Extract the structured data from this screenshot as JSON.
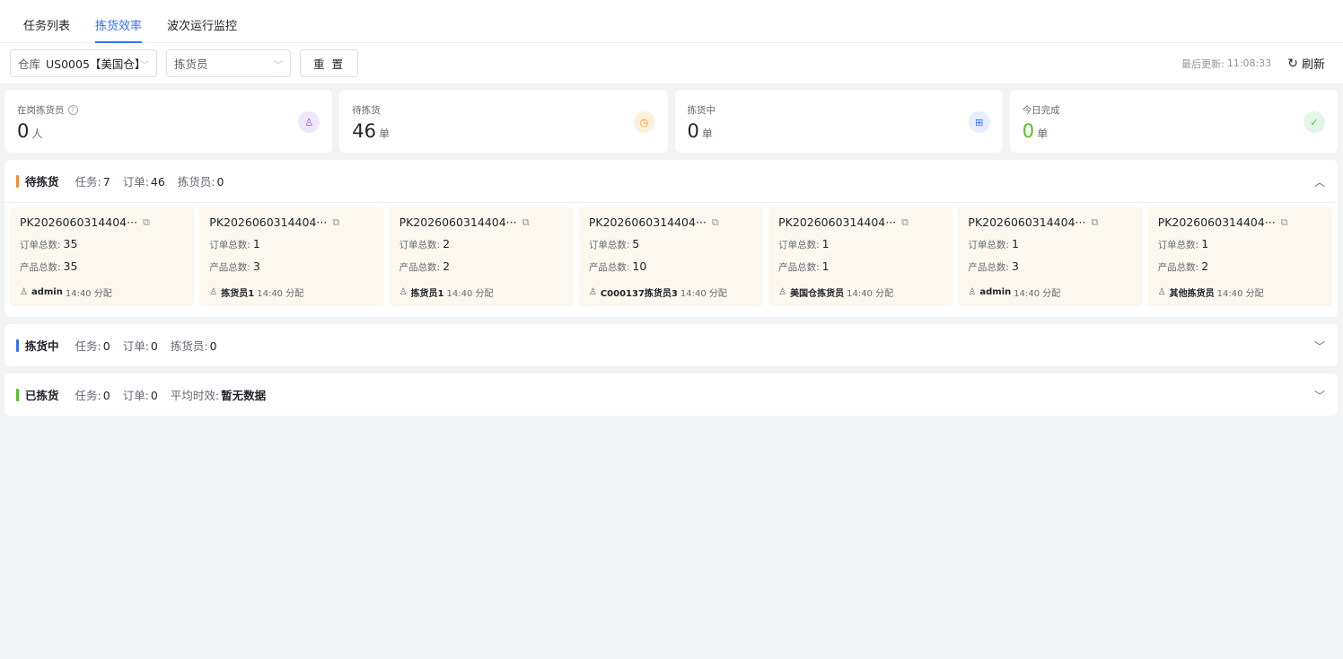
{
  "tabs": [
    "任务列表",
    "拣货效率",
    "波次运行监控"
  ],
  "active_tab": 1,
  "filters": {
    "warehouse_label": "仓库",
    "warehouse_value": "US0005【美国仓】",
    "picker_placeholder": "拣货员",
    "reset_label": "重 置"
  },
  "header_right": {
    "last_update_label": "最后更新:",
    "last_update_time": "11:08:33",
    "refresh_label": "刷新"
  },
  "stats": [
    {
      "label": "在岗拣货员",
      "value": "0",
      "unit": "人",
      "icon": "user-icon",
      "help": "?"
    },
    {
      "label": "待拣货",
      "value": "46",
      "unit": "单",
      "icon": "clock-icon"
    },
    {
      "label": "拣货中",
      "value": "0",
      "unit": "单",
      "icon": "grid-icon"
    },
    {
      "label": "今日完成",
      "value": "0",
      "unit": "单",
      "icon": "check-icon",
      "color": "#52c41a"
    }
  ],
  "sections": {
    "pending": {
      "title": "待拣货",
      "color": "#fa8c16",
      "task_label": "任务:",
      "task_value": "7",
      "order_label": "订单:",
      "order_value": "46",
      "picker_label": "拣货员:",
      "picker_value": "0"
    },
    "picking": {
      "title": "拣货中",
      "color": "#3370ff",
      "task_label": "任务:",
      "task_value": "0",
      "order_label": "订单:",
      "order_value": "0",
      "picker_label": "拣货员:",
      "picker_value": "0"
    },
    "picked": {
      "title": "已拣货",
      "color": "#52c41a",
      "task_label": "任务:",
      "task_value": "0",
      "order_label": "订单:",
      "order_value": "0",
      "avg_label": "平均时效:",
      "avg_value": "暂无数据"
    }
  },
  "card_labels": {
    "orders": "订单总数:",
    "products": "产品总数:"
  },
  "cards": [
    {
      "code": "PK2026060314404···",
      "orders": "35",
      "products": "35",
      "user": "admin",
      "time": "14:40 分配"
    },
    {
      "code": "PK2026060314404···",
      "orders": "1",
      "products": "3",
      "user": "拣货员1",
      "time": "14:40 分配"
    },
    {
      "code": "PK2026060314404···",
      "orders": "2",
      "products": "2",
      "user": "拣货员1",
      "time": "14:40 分配"
    },
    {
      "code": "PK2026060314404···",
      "orders": "5",
      "products": "10",
      "user": "C000137拣货员3",
      "time": "14:40 分配"
    },
    {
      "code": "PK2026060314404···",
      "orders": "1",
      "products": "1",
      "user": "美国仓拣货员",
      "time": "14:40 分配"
    },
    {
      "code": "PK2026060314404···",
      "orders": "1",
      "products": "3",
      "user": "admin",
      "time": "14:40 分配"
    },
    {
      "code": "PK2026060314404···",
      "orders": "1",
      "products": "2",
      "user": "其他拣货员",
      "time": "14:40 分配"
    }
  ]
}
